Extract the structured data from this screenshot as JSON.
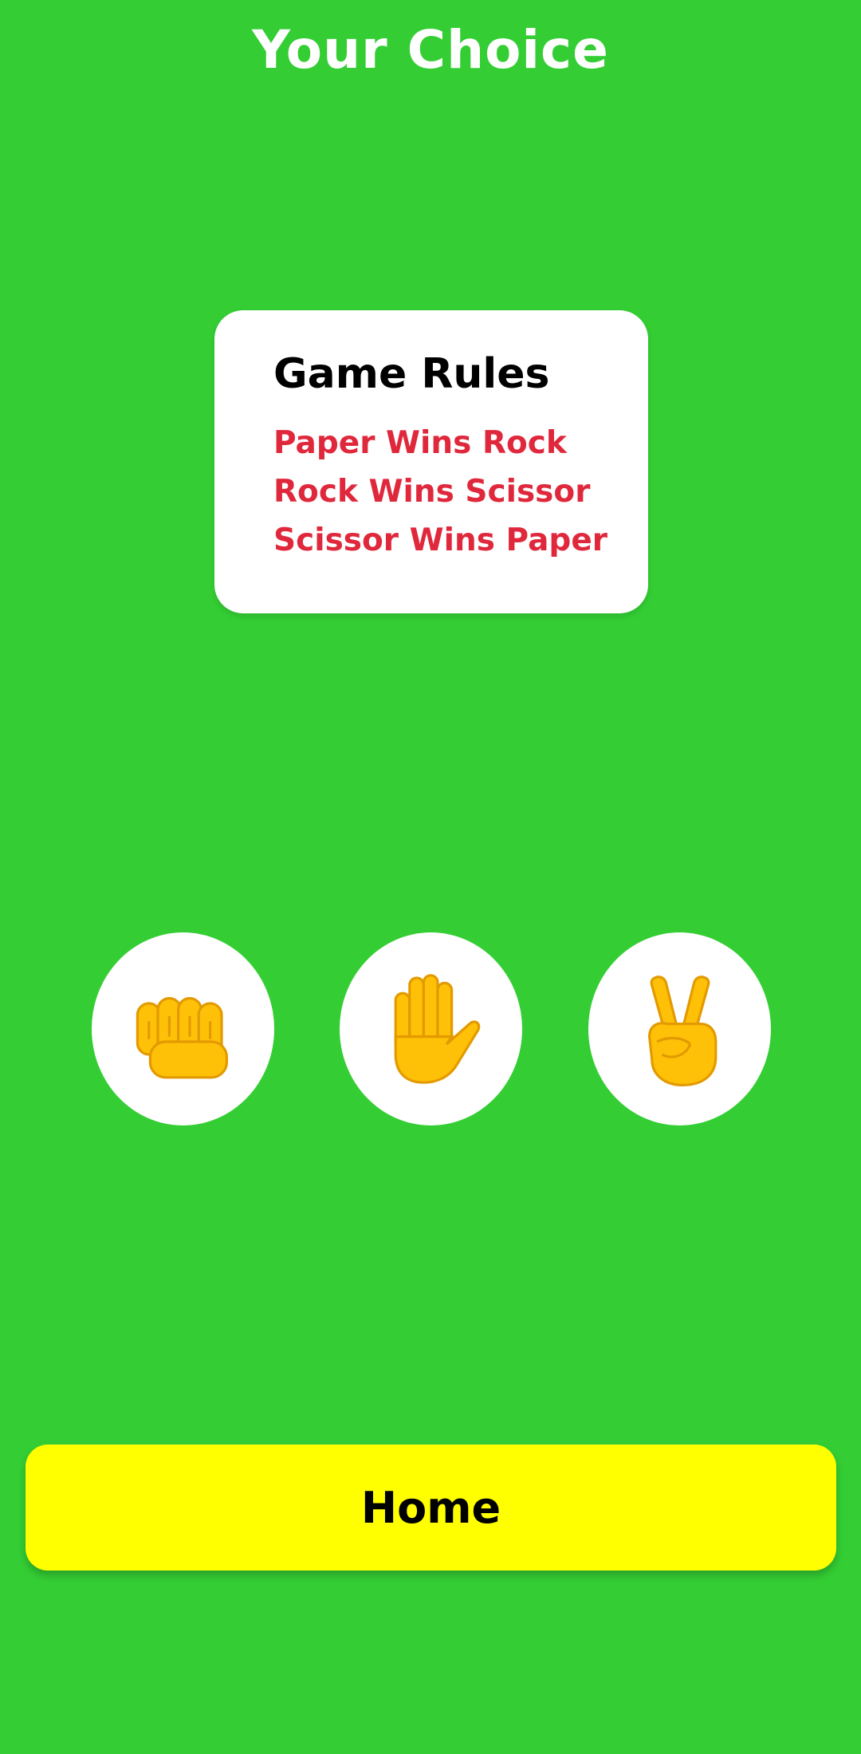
{
  "header": {
    "title": "Your Choice"
  },
  "rules": {
    "title": "Game Rules",
    "lines": [
      "Paper Wins Rock",
      "Rock Wins Scissor",
      "Scissor Wins Paper"
    ]
  },
  "choices": [
    {
      "name": "rock",
      "icon": "fist-icon"
    },
    {
      "name": "paper",
      "icon": "raised-hand-icon"
    },
    {
      "name": "scissors",
      "icon": "victory-hand-icon"
    }
  ],
  "home_button": {
    "label": "Home"
  },
  "colors": {
    "background": "#34CE34",
    "card": "#FFFFFF",
    "rule_text": "#E0283C",
    "button": "#FFFF00",
    "emoji_fill": "#FFC107",
    "emoji_stroke": "#E39A00"
  }
}
